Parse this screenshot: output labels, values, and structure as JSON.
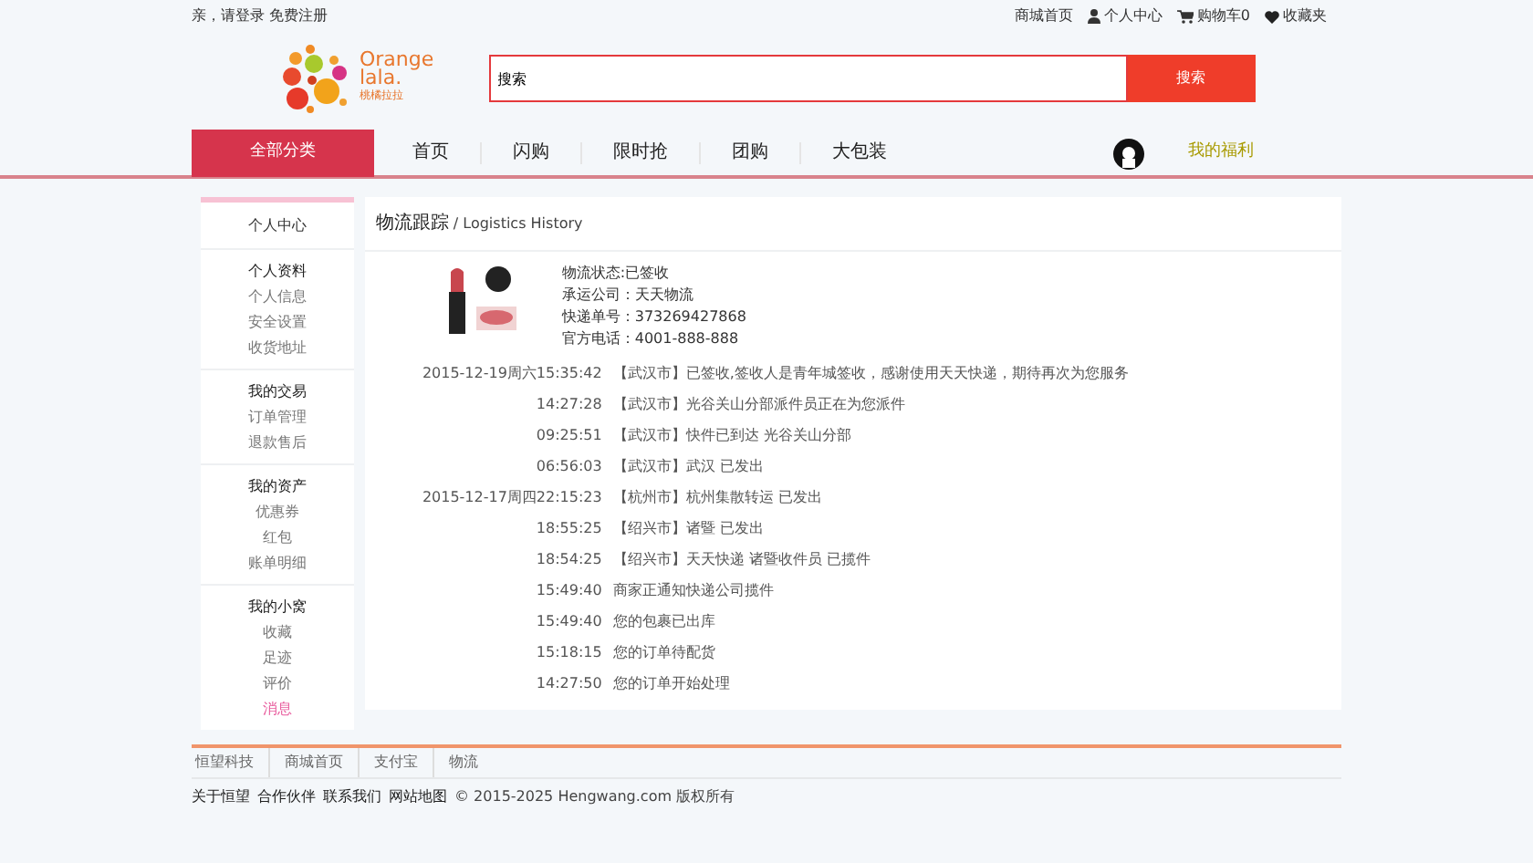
{
  "top_bar": {
    "greeting": "亲，请登录 免费注册",
    "links": [
      {
        "kind": "text",
        "label": "商城首页"
      },
      {
        "kind": "user",
        "label": "个人中心"
      },
      {
        "kind": "cart",
        "label": "购物车0"
      },
      {
        "kind": "heart",
        "label": "收藏夹"
      }
    ]
  },
  "logo": {
    "name": "Orange",
    "name2": "lala.",
    "tagline": "桃橘拉拉"
  },
  "search": {
    "value": "搜索",
    "button": "搜索"
  },
  "nav": {
    "category_button": "全部分类",
    "items": [
      "首页",
      "闪购",
      "限时抢",
      "团购",
      "大包装"
    ],
    "welfare": "我的福利"
  },
  "sidebar": {
    "title": "个人中心",
    "groups": [
      {
        "title": "个人资料",
        "items": [
          {
            "label": "个人信息",
            "selected": false
          },
          {
            "label": "安全设置",
            "selected": false
          },
          {
            "label": "收货地址",
            "selected": false
          }
        ]
      },
      {
        "title": "我的交易",
        "items": [
          {
            "label": "订单管理",
            "selected": false
          },
          {
            "label": "退款售后",
            "selected": false
          }
        ]
      },
      {
        "title": "我的资产",
        "items": [
          {
            "label": "优惠券",
            "selected": false
          },
          {
            "label": "红包",
            "selected": false
          },
          {
            "label": "账单明细",
            "selected": false
          }
        ]
      },
      {
        "title": "我的小窝",
        "items": [
          {
            "label": "收藏",
            "selected": false
          },
          {
            "label": "足迹",
            "selected": false
          },
          {
            "label": "评价",
            "selected": false
          },
          {
            "label": "消息",
            "selected": true
          }
        ]
      }
    ]
  },
  "main": {
    "title": "物流跟踪",
    "subtitle": " / Logistics History",
    "package": {
      "lines": [
        "物流状态:已签收",
        "承运公司：天天物流",
        "快递单号：373269427868",
        "官方电话：4001-888-888"
      ]
    },
    "events": [
      {
        "time": "2015-12-19周六15:35:42",
        "text": "【武汉市】已签收,签收人是青年城签收，感谢使用天天快递，期待再次为您服务"
      },
      {
        "time": "14:27:28",
        "text": "【武汉市】光谷关山分部派件员正在为您派件"
      },
      {
        "time": "09:25:51",
        "text": "【武汉市】快件已到达 光谷关山分部"
      },
      {
        "time": "06:56:03",
        "text": "【武汉市】武汉 已发出"
      },
      {
        "time": "2015-12-17周四22:15:23",
        "text": "【杭州市】杭州集散转运 已发出"
      },
      {
        "time": "18:55:25",
        "text": "【绍兴市】诸暨 已发出"
      },
      {
        "time": "18:54:25",
        "text": "【绍兴市】天天快递 诸暨收件员 已揽件"
      },
      {
        "time": "15:49:40",
        "text": "商家正通知快递公司揽件"
      },
      {
        "time": "15:49:40",
        "text": "您的包裹已出库"
      },
      {
        "time": "15:18:15",
        "text": "您的订单待配货"
      },
      {
        "time": "14:27:50",
        "text": "您的订单开始处理"
      }
    ]
  },
  "footer": {
    "links": [
      "恒望科技",
      "商城首页",
      "支付宝",
      "物流"
    ],
    "bottom_links": [
      "关于恒望",
      "合作伙伴",
      "联系我们",
      "网站地图"
    ],
    "copyright": "© 2015-2025 Hengwang.com 版权所有"
  }
}
